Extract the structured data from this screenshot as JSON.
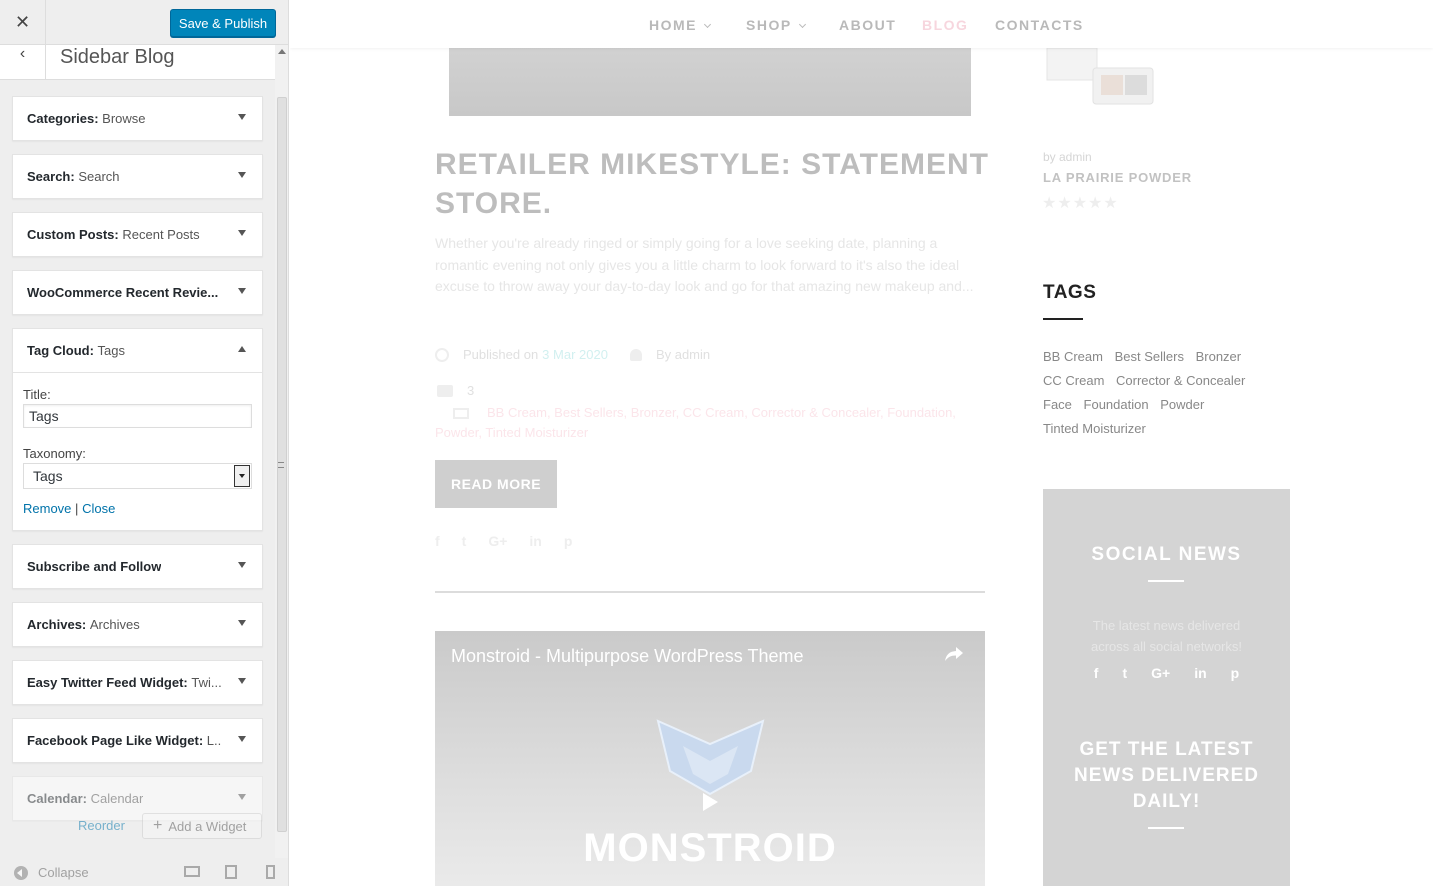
{
  "customizer": {
    "close_icon_glyph": "✕",
    "publish_label": "Save & Publish",
    "back_glyph": "‹",
    "section_title": "Sidebar Blog",
    "widgets": [
      {
        "name": "Categories",
        "sub": "Browse"
      },
      {
        "name": "Search",
        "sub": "Search"
      },
      {
        "name": "Custom Posts",
        "sub": "Recent Posts"
      },
      {
        "name": "WooCommerce Recent Revie...",
        "sub": ""
      },
      {
        "name": "Tag Cloud",
        "sub": "Tags"
      },
      {
        "name": "Subscribe and Follow",
        "sub": ""
      },
      {
        "name": "Archives",
        "sub": "Archives"
      },
      {
        "name": "Easy Twitter Feed Widget",
        "sub": "Twi..."
      },
      {
        "name": "Facebook Page Like Widget",
        "sub": "L..."
      },
      {
        "name": "Calendar",
        "sub": "Calendar"
      }
    ],
    "tag_cloud_form": {
      "title_label": "Title:",
      "title_value": "Tags",
      "taxonomy_label": "Taxonomy:",
      "taxonomy_value": "Tags",
      "remove": "Remove",
      "separator": "|",
      "close": "Close"
    },
    "reorder": "Reorder",
    "add_widget": "Add a Widget",
    "collapse": "Collapse"
  },
  "preview": {
    "nav": {
      "home": "HOME",
      "shop": "SHOP",
      "about": "ABOUT",
      "blog": "BLOG",
      "contacts": "CONTACTS"
    },
    "post": {
      "title": "RETAILER MIKESTYLE: STATEMENT STORE.",
      "excerpt": "Whether you're already ringed or simply going for a love seeking date, planning a romantic evening not only gives you a little charm to look forward to it's also the ideal excuse to throw away your day-to-day look and go for that amazing new makeup and...",
      "published_prefix": "Published on",
      "published_date": "3 Mar 2020",
      "author": "By admin",
      "comments": "3",
      "categories": "BB Cream,  Best Sellers,  Bronzer,  CC Cream,  Corrector & Concealer,  Foundation,  Powder,  Tinted Moisturizer",
      "read_more": "READ MORE",
      "share_icons": [
        "f",
        "t",
        "G+",
        "in",
        "p"
      ]
    },
    "video": {
      "title": "Monstroid - Multipurpose WordPress Theme",
      "brand": "MONSTROID"
    },
    "product": {
      "by": "by admin",
      "name": "LA PRAIRIE POWDER",
      "stars": "★★★★★"
    },
    "tags": {
      "title": "TAGS",
      "items": [
        "BB Cream",
        "Best Sellers",
        "Bronzer",
        "CC Cream",
        "Corrector & Concealer",
        "Face",
        "Foundation",
        "Powder",
        "Tinted Moisturizer"
      ]
    },
    "social": {
      "title": "SOCIAL NEWS",
      "desc": "The latest news delivered across all social networks!",
      "icons": [
        "f",
        "t",
        "G+",
        "in",
        "p"
      ],
      "newsletter": "GET THE LATEST NEWS DELIVERED DAILY!"
    }
  }
}
